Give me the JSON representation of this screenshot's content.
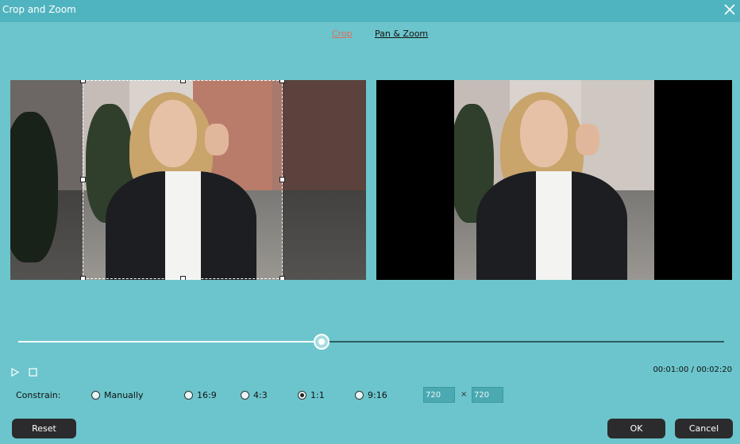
{
  "window": {
    "title": "Crop and Zoom",
    "close_icon": "close-icon"
  },
  "tabs": [
    {
      "label": "Crop",
      "active": true,
      "color": "#e06a5e"
    },
    {
      "label": "Pan & Zoom",
      "active": false
    }
  ],
  "preview": {
    "left_image": "photo-woman-smiling-leather-jacket-with-crop-box",
    "right_image": "photo-woman-smiling-cropped-1-1-with-black-bars"
  },
  "player": {
    "play_icon": "play-icon",
    "stop_icon": "stop-icon",
    "timecode": "00:01:00 / 00:02:20",
    "progress": 0.43
  },
  "constrain": {
    "label": "Constrain:",
    "options": [
      "Manually",
      "16:9",
      "4:3",
      "1:1",
      "9:16"
    ],
    "selected": "1:1",
    "width": "720",
    "height": "720",
    "separator": "×"
  },
  "buttons": {
    "reset": "Reset",
    "ok": "OK",
    "cancel": "Cancel"
  },
  "colors": {
    "background": "#6cc5cc",
    "titlebar": "#4fb4bf",
    "button": "#2b2b2d",
    "accent": "#e06a5e"
  }
}
